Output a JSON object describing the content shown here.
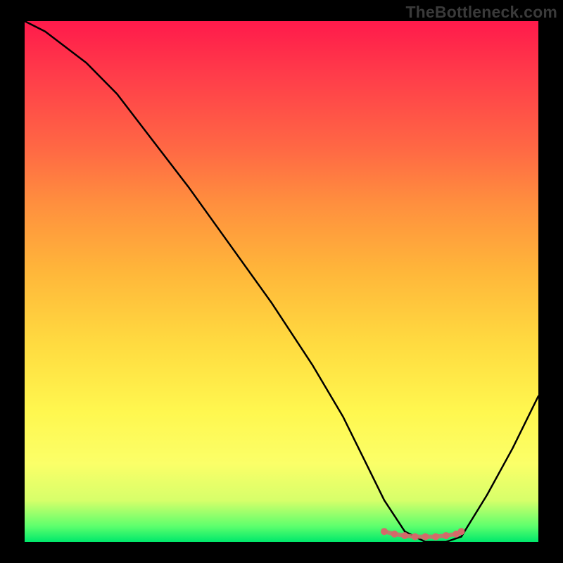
{
  "watermark": "TheBottleneck.com",
  "colors": {
    "background": "#000000",
    "curve": "#000000",
    "marker": "#d46a6a",
    "gradient_top": "#ff1a4b",
    "gradient_bottom": "#00e86b"
  },
  "chart_data": {
    "type": "line",
    "title": "",
    "xlabel": "",
    "ylabel": "",
    "x_range": [
      0,
      100
    ],
    "y_range": [
      0,
      100
    ],
    "series": [
      {
        "name": "bottleneck-curve",
        "x": [
          0,
          4,
          8,
          12,
          18,
          25,
          32,
          40,
          48,
          56,
          62,
          66,
          70,
          74,
          78,
          80,
          82,
          85,
          90,
          95,
          100
        ],
        "y": [
          100,
          98,
          95,
          92,
          86,
          77,
          68,
          57,
          46,
          34,
          24,
          16,
          8,
          2,
          0,
          0,
          0,
          1,
          9,
          18,
          28
        ]
      }
    ],
    "markers": {
      "name": "optimal-band",
      "x": [
        70,
        72,
        74,
        76,
        78,
        80,
        82,
        84,
        85
      ],
      "y": [
        2.0,
        1.5,
        1.2,
        1.0,
        1.0,
        1.0,
        1.2,
        1.5,
        2.0
      ]
    }
  }
}
